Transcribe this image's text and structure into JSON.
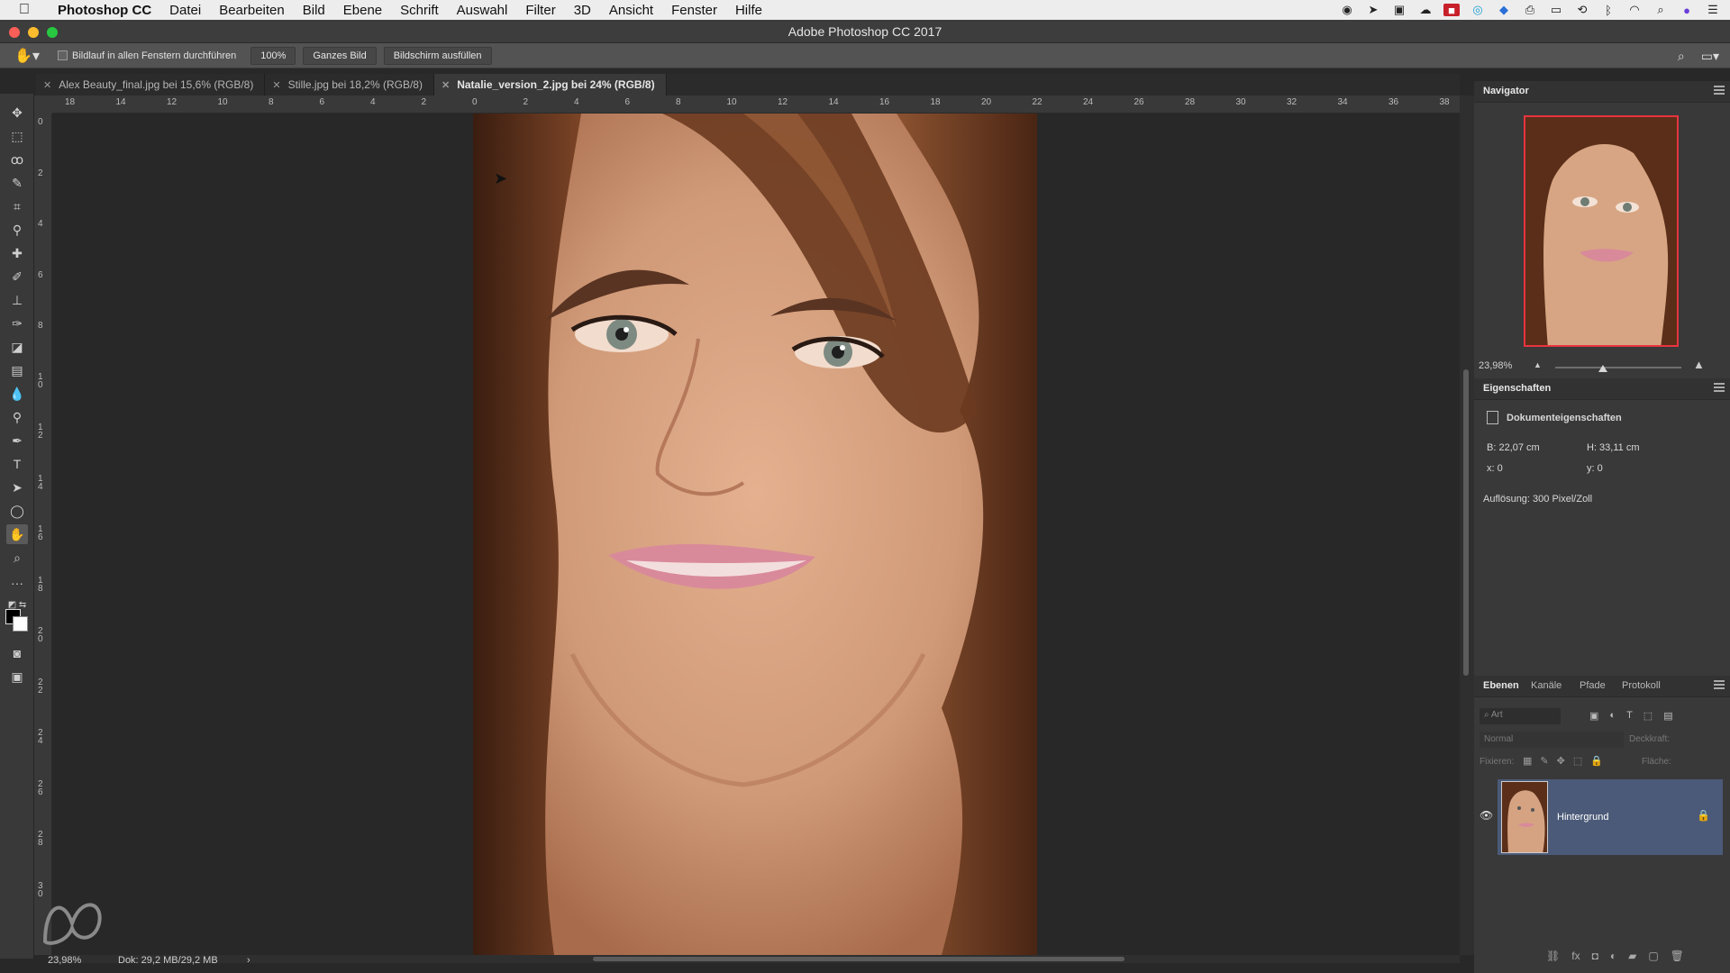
{
  "menubar": {
    "apple_icon": "apple-logo-icon",
    "items": [
      "Photoshop CC",
      "Datei",
      "Bearbeiten",
      "Bild",
      "Ebene",
      "Schrift",
      "Auswahl",
      "Filter",
      "3D",
      "Ansicht",
      "Fenster",
      "Hilfe"
    ]
  },
  "window": {
    "title": "Adobe Photoshop CC 2017"
  },
  "options": {
    "scroll_all_label": "Bildlauf in allen Fenstern durchführen",
    "zoom_100_label": "100%",
    "fit_screen_label": "Ganzes Bild",
    "fill_screen_label": "Bildschirm ausfüllen"
  },
  "tabs": [
    {
      "label": "Alex Beauty_final.jpg bei 15,6% (RGB/8)"
    },
    {
      "label": "Stille.jpg bei 18,2% (RGB/8)"
    },
    {
      "label": "Natalie_version_2.jpg bei 24% (RGB/8)"
    }
  ],
  "ruler": {
    "top_labels": [
      "18",
      "14",
      "12",
      "10",
      "8",
      "6",
      "4",
      "2",
      "0",
      "2",
      "4",
      "6",
      "8",
      "10",
      "12",
      "14",
      "16",
      "18",
      "20",
      "22",
      "24",
      "26",
      "28",
      "30",
      "32",
      "34",
      "36",
      "38"
    ],
    "left_labels": [
      "0",
      "2",
      "4",
      "6",
      "8",
      "1 0",
      "1 2",
      "1 4",
      "1 6",
      "1 8",
      "2 0",
      "2 2",
      "2 4",
      "2 6",
      "2 8",
      "3 0"
    ]
  },
  "status": {
    "zoom": "23,98%",
    "doc": "Dok: 29,2 MB/29,2 MB",
    "arrow": "›"
  },
  "navigator": {
    "title": "Navigator",
    "zoom": "23,98%",
    "zoom_level": 0.38
  },
  "properties": {
    "title": "Eigenschaften",
    "doc_props": "Dokumenteigenschaften",
    "width": "B: 22,07 cm",
    "height": "H: 33,11 cm",
    "x": "x: 0",
    "y": "y: 0",
    "resolution": "Auflösung: 300 Pixel/Zoll"
  },
  "layers_panel": {
    "tabs": [
      "Ebenen",
      "Kanäle",
      "Pfade",
      "Protokoll"
    ],
    "search_placeholder": "Art",
    "blend_mode": "Normal",
    "opacity_label": "Deckkraft:",
    "lock_label": "Fixieren:",
    "fill_label": "Fläche:",
    "layer_name": "Hintergrund"
  },
  "colors": {
    "accent_selected_layer": "#4b5a78",
    "navigator_frame": "#e8343f"
  }
}
